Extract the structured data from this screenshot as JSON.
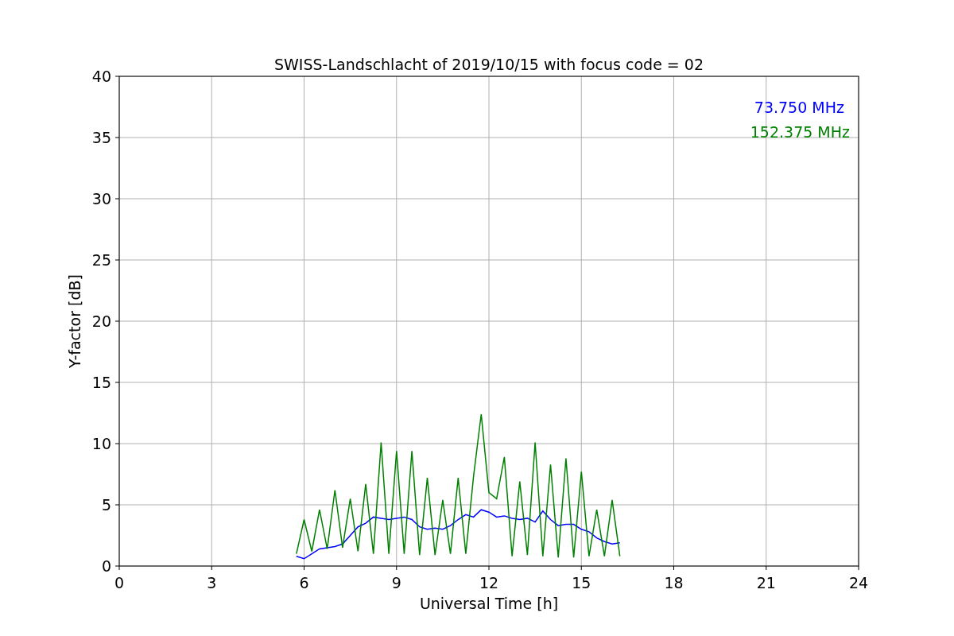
{
  "figure": {
    "chart_data": {
      "type": "line",
      "title": "SWISS-Landschlacht of 2019/10/15 with focus code = 02",
      "xlabel": "Universal Time [h]",
      "ylabel": "Y-factor [dB]",
      "grid": true,
      "xlim": [
        0,
        24
      ],
      "ylim": [
        0,
        40
      ],
      "xticks": [
        0,
        3,
        6,
        9,
        12,
        15,
        18,
        21,
        24
      ],
      "yticks": [
        0,
        5,
        10,
        15,
        20,
        25,
        30,
        35,
        40
      ],
      "x": [
        5.75,
        6,
        6.25,
        6.5,
        6.75,
        7,
        7.25,
        7.5,
        7.75,
        8,
        8.25,
        8.5,
        8.75,
        9,
        9.25,
        9.5,
        9.75,
        10,
        10.25,
        10.5,
        10.75,
        11,
        11.25,
        11.5,
        11.75,
        12,
        12.25,
        12.5,
        12.75,
        13,
        13.25,
        13.5,
        13.75,
        14,
        14.25,
        14.5,
        14.75,
        15,
        15.25,
        15.5,
        15.75,
        16,
        16.25
      ],
      "series": [
        {
          "name": "73.750 MHz",
          "color": "#0000ff",
          "values": [
            0.8,
            0.6,
            1.0,
            1.4,
            1.5,
            1.6,
            1.8,
            2.5,
            3.2,
            3.5,
            4.0,
            3.9,
            3.8,
            3.9,
            4.0,
            3.8,
            3.2,
            3.0,
            3.1,
            3.0,
            3.3,
            3.8,
            4.2,
            4.0,
            4.6,
            4.4,
            4.0,
            4.1,
            3.9,
            3.8,
            3.9,
            3.6,
            4.5,
            3.8,
            3.3,
            3.4,
            3.4,
            3.0,
            2.8,
            2.3,
            2.0,
            1.8,
            1.9
          ]
        },
        {
          "name": "152.375 MHz",
          "color": "#008000",
          "values": [
            1.0,
            3.8,
            1.2,
            4.6,
            1.4,
            6.2,
            1.5,
            5.5,
            1.2,
            6.7,
            1.0,
            10.1,
            1.0,
            9.4,
            1.0,
            9.4,
            0.9,
            7.2,
            0.9,
            5.4,
            1.0,
            7.2,
            1.0,
            7.3,
            12.4,
            6.0,
            5.5,
            8.9,
            0.8,
            6.9,
            0.9,
            10.1,
            0.8,
            8.3,
            0.7,
            8.8,
            0.7,
            7.7,
            0.8,
            4.6,
            0.8,
            5.4,
            0.8
          ]
        }
      ]
    }
  }
}
